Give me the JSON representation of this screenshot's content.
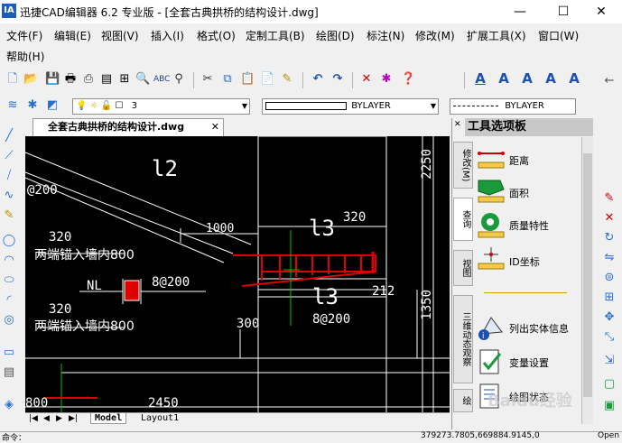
{
  "window": {
    "logo": "IA",
    "title": "迅捷CAD编辑器 6.2 专业版  - [全套古典拱桥的结构设计.dwg]",
    "controls": {
      "minimize": "—",
      "maximize": "☐",
      "close": "✕"
    }
  },
  "menu": {
    "items": [
      "文件(F)",
      "编辑(E)",
      "视图(V)",
      "插入(I)",
      "格式(O)",
      "定制工具(B)",
      "绘图(D)",
      "标注(N)",
      "修改(M)",
      "扩展工具(X)",
      "窗口(W)",
      "帮助(H)"
    ]
  },
  "layer_toolbar": {
    "layer_value": "3",
    "linetype_value": "BYLAYER",
    "lineweight_value": "BYLAYER"
  },
  "document": {
    "tab_label": "全套古典拱桥的结构设计.dwg"
  },
  "drawing": {
    "labels": {
      "l2": "l2",
      "at200": "@200",
      "d320a": "320",
      "anchor1": "两端锚入墙内800",
      "nl": "NL",
      "s8a200": "8@200",
      "d320b": "320",
      "anchor2": "两端锚入墙内800",
      "d1000": "1000",
      "l3a": "l3",
      "d320c": "320",
      "l3b": "l3",
      "d212": "212",
      "d300": "300",
      "s8b200": "8@200",
      "d2250": "2250",
      "d1350": "1350",
      "d2450": "2450",
      "d800": "800"
    }
  },
  "layouts": {
    "model": "Model",
    "layout1": "Layout1"
  },
  "palette": {
    "title": "工具选项板",
    "tabs": [
      "修改(M)",
      "查询",
      "视图",
      "三维动态观察",
      "绘"
    ],
    "tools": [
      "距离",
      "面积",
      "质量特性",
      "ID坐标",
      "列出实体信息",
      "变量设置",
      "绘图状态"
    ]
  },
  "statusbar": {
    "command": "命令：",
    "coords": "379273.7805,669884.9145,0",
    "right": "Open"
  },
  "watermark": "Baidu经验"
}
